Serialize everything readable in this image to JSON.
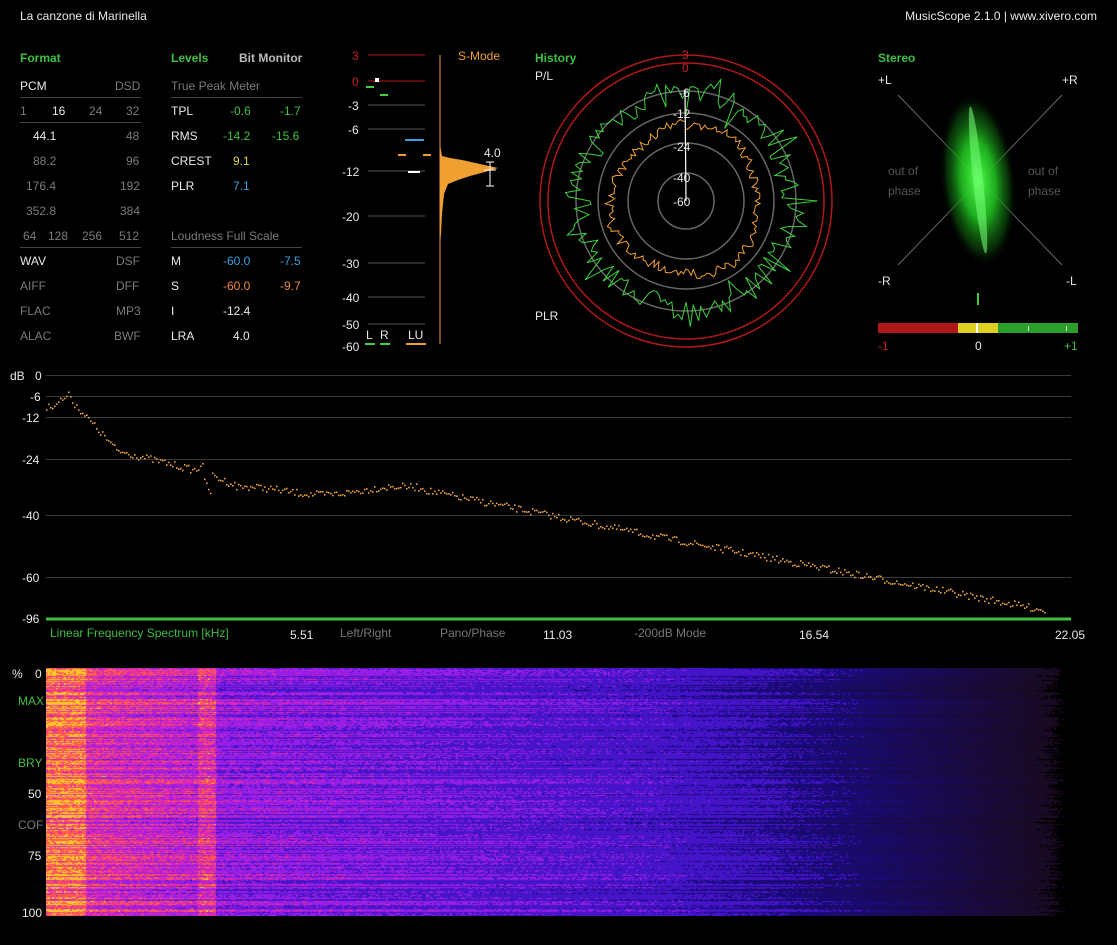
{
  "window": {
    "title": "La canzone di Marinella",
    "app": "MusicScope 2.1.0 | www.xivero.com"
  },
  "format": {
    "title": "Format",
    "left_head": "PCM",
    "right_head": "DSD",
    "bits": [
      "1",
      "16",
      "24",
      "32"
    ],
    "rates_left": [
      "44.1",
      "88.2",
      "176.4",
      "352.8"
    ],
    "rates_right": [
      "48",
      "96",
      "192",
      "384"
    ],
    "dsd": [
      "64",
      "128",
      "256",
      "512"
    ],
    "files_left": [
      "WAV",
      "AIFF",
      "FLAC",
      "ALAC"
    ],
    "files_right": [
      "DSF",
      "DFF",
      "MP3",
      "BWF"
    ]
  },
  "levels": {
    "title": "Levels",
    "bit_monitor": "Bit Monitor",
    "tpm_title": "True Peak Meter",
    "rows": [
      {
        "label": "TPL",
        "a": "-0.6",
        "b": "-1.7"
      },
      {
        "label": "RMS",
        "a": "-14.2",
        "b": "-15.6"
      },
      {
        "label": "CREST",
        "a": "9.1"
      },
      {
        "label": "PLR",
        "a": "7.1"
      }
    ],
    "lfs_title": "Loudness Full Scale",
    "lrows": [
      {
        "label": "M",
        "a": "-60.0",
        "b": "-7.5"
      },
      {
        "label": "S",
        "a": "-60.0",
        "b": "-9.7"
      },
      {
        "label": "I",
        "a": "-12.4"
      },
      {
        "label": "LRA",
        "a": "4.0"
      }
    ]
  },
  "meter": {
    "smode": "S-Mode",
    "scale": [
      "3",
      "0",
      "-3",
      "-6",
      "-12",
      "-20",
      "-30",
      "-40",
      "-50",
      "-60"
    ],
    "lra_value": "4.0",
    "ch": [
      "L",
      "R",
      "LU"
    ]
  },
  "history": {
    "title": "History",
    "pl": "P/L",
    "plr": "PLR",
    "rings": [
      "3",
      "0",
      "-6",
      "-12",
      "-24",
      "-40",
      "-60"
    ]
  },
  "stereo": {
    "title": "Stereo",
    "pl": "+L",
    "pr": "+R",
    "ml": "-R",
    "mr": "-L",
    "oop": "out of",
    "phase": "phase",
    "bar": [
      "-1",
      "0",
      "+1"
    ]
  },
  "spectrum": {
    "unit": "dB",
    "dbticks": [
      "0",
      "-6",
      "-12",
      "-24",
      "-40",
      "-60",
      "-96"
    ],
    "label": "Linear Frequency Spectrum [kHz]",
    "freqs": [
      "5.51",
      "11.03",
      "16.54",
      "22.05"
    ],
    "buttons": [
      "Left/Right",
      "Pano/Phase",
      "-200dB Mode"
    ]
  },
  "spectrogram": {
    "ticks": [
      "%",
      "0",
      "MAX",
      "BRY",
      "50",
      "COF",
      "75",
      "100"
    ]
  },
  "colors": {
    "accent": "#3fbf3f",
    "orange": "#f0a030",
    "red": "#c81e1e",
    "blue": "#3aa0e0"
  }
}
